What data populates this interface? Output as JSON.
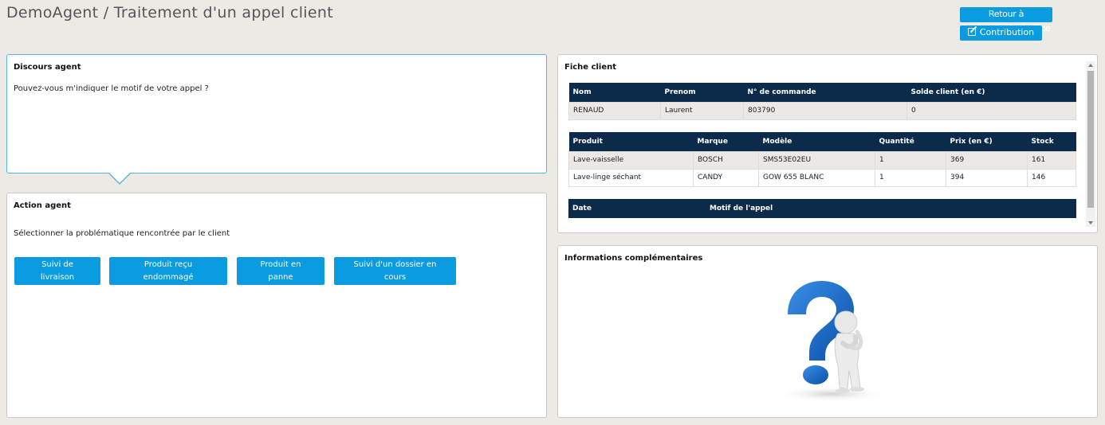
{
  "header": {
    "title": "DemoAgent / Traitement d'un appel client",
    "retour_label": "Retour à DashboardBackoffice",
    "contribution_label": "Contribution"
  },
  "discours": {
    "title": "Discours agent",
    "text": "Pouvez-vous m'indiquer le motif de votre appel ?"
  },
  "action": {
    "title": "Action agent",
    "text": "Sélectionner la problématique rencontrée par le client",
    "buttons": [
      {
        "line1": "Suivi de",
        "line2": "livraison"
      },
      {
        "line1": "Produit reçu",
        "line2": "endommagé"
      },
      {
        "line1": "Produit en",
        "line2": "panne"
      },
      {
        "line1": "Suivi d'un dossier en",
        "line2": "cours"
      }
    ]
  },
  "fiche": {
    "title": "Fiche client",
    "client_headers": [
      "Nom",
      "Prenom",
      "N° de commande",
      "Solde client (en €)"
    ],
    "client_row": [
      "RENAUD",
      "Laurent",
      "803790",
      "0"
    ],
    "produit_headers": [
      "Produit",
      "Marque",
      "Modèle",
      "Quantité",
      "Prix (en €)",
      "Stock"
    ],
    "produit_rows": [
      [
        "Lave-vaisselle",
        "BOSCH",
        "SMS53E02EU",
        "1",
        "369",
        "161"
      ],
      [
        "Lave-linge séchant",
        "CANDY",
        "GOW 655 BLANC",
        "1",
        "394",
        "146"
      ]
    ],
    "motif_headers": [
      "Date",
      "Motif de l'appel"
    ]
  },
  "infos": {
    "title": "Informations complémentaires",
    "image_icon": "question-mark-figure-icon"
  },
  "colors": {
    "accent": "#0a9be0",
    "table_header": "#0c2a4a",
    "background": "#edeae6"
  }
}
